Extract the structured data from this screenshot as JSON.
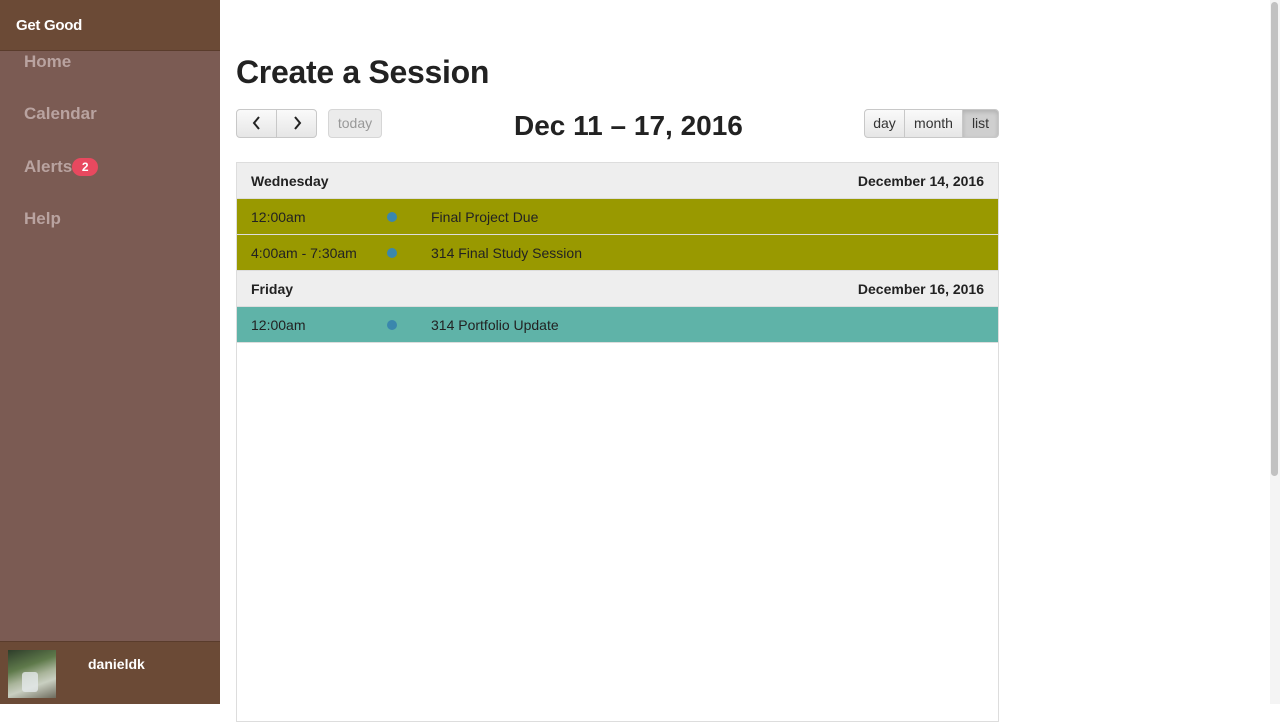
{
  "sidebar": {
    "brand": "Get Good",
    "nav": {
      "home": "Home",
      "calendar": "Calendar",
      "alerts": "Alerts",
      "alerts_count": "2",
      "help": "Help"
    },
    "user": {
      "name": "danieldk"
    }
  },
  "page": {
    "title": "Create a Session"
  },
  "toolbar": {
    "prev_icon": "chevron-left-icon",
    "next_icon": "chevron-right-icon",
    "today": "today",
    "range": "Dec 11 – 17, 2016",
    "views": {
      "day": "day",
      "month": "month",
      "list": "list"
    },
    "active_view": "list"
  },
  "list": {
    "days": [
      {
        "day_name": "Wednesday",
        "date": "December 14, 2016",
        "events": [
          {
            "time": "12:00am",
            "title": "Final Project Due",
            "color": "#999900"
          },
          {
            "time": "4:00am - 7:30am",
            "title": "314 Final Study Session",
            "color": "#999900"
          }
        ]
      },
      {
        "day_name": "Friday",
        "date": "December 16, 2016",
        "events": [
          {
            "time": "12:00am",
            "title": "314 Portfolio Update",
            "color": "#5fb3a8"
          }
        ]
      }
    ]
  },
  "colors": {
    "sidebar": "#7b5b53",
    "sidebar_header": "#6b4a36",
    "badge": "#e8495f",
    "event_dot": "#3a87ad"
  }
}
